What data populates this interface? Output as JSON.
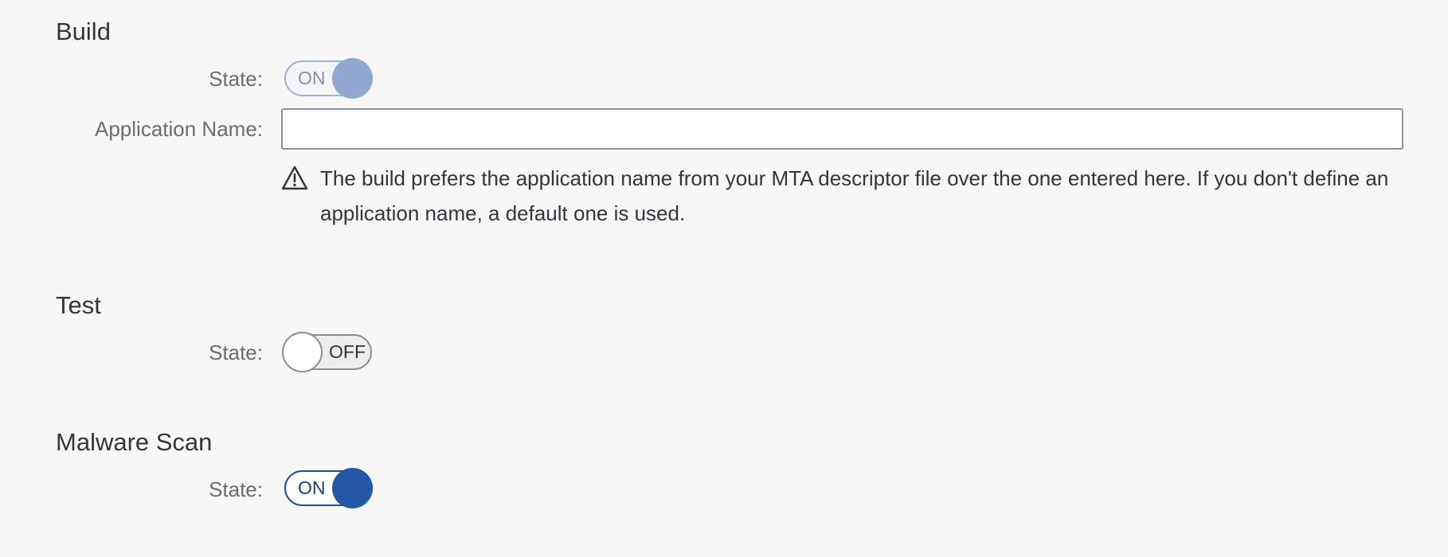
{
  "build": {
    "title": "Build",
    "state_label": "State:",
    "switch_text": "ON",
    "app_name_label": "Application Name:",
    "app_name_value": "",
    "app_name_placeholder": "",
    "warning_icon": "warning-icon",
    "warning_text": "The build prefers the application name from your MTA descriptor file over the one entered here. If you don't define an application name, a default one is used."
  },
  "test": {
    "title": "Test",
    "state_label": "State:",
    "switch_text": "OFF"
  },
  "malware_scan": {
    "title": "Malware Scan",
    "state_label": "State:",
    "switch_text": "ON"
  },
  "colors": {
    "background": "#f7f7f7",
    "switch_on_knob": "#2356a3",
    "switch_on_disabled_knob": "#90a8cf",
    "switch_off_knob": "#ffffff",
    "text": "#32363a",
    "label": "#6a6d70"
  }
}
